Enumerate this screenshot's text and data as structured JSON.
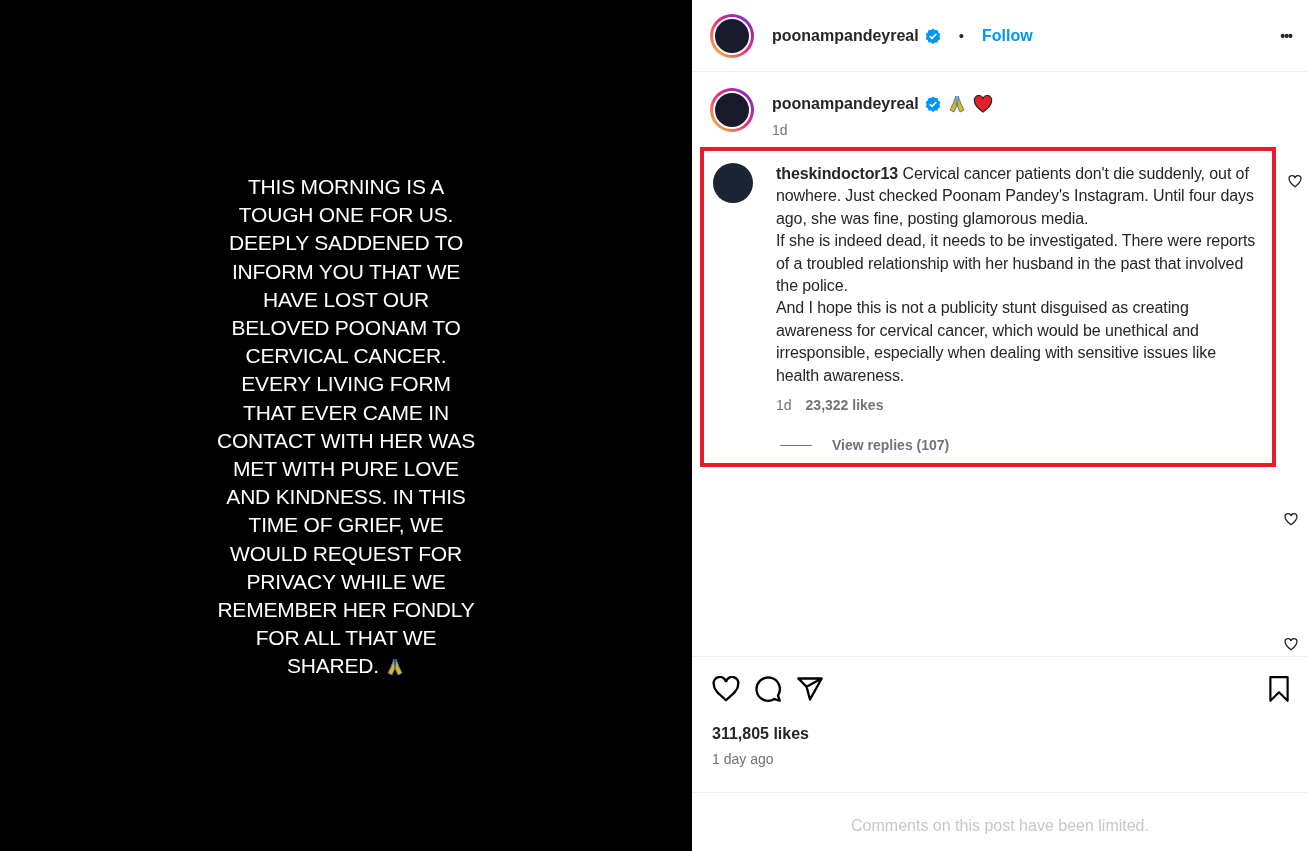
{
  "post_image": {
    "lines": [
      "THIS MORNING IS A",
      "TOUGH ONE FOR US.",
      "DEEPLY SADDENED TO",
      "INFORM YOU THAT WE",
      "HAVE LOST OUR",
      "BELOVED POONAM TO",
      "CERVICAL CANCER.",
      "EVERY LIVING FORM",
      "THAT EVER CAME IN",
      "CONTACT WITH HER WAS",
      "MET WITH PURE LOVE",
      "AND KINDNESS. IN THIS",
      "TIME OF GRIEF, WE",
      "WOULD REQUEST FOR",
      "PRIVACY WHILE WE",
      "REMEMBER HER FONDLY",
      "FOR ALL THAT WE",
      "SHARED."
    ]
  },
  "header": {
    "username": "poonampandeyreal",
    "verified": true,
    "separator": "•",
    "follow": "Follow",
    "more": "•••"
  },
  "caption": {
    "username": "poonampandeyreal",
    "verified": true,
    "time": "1d"
  },
  "comments": [
    {
      "text": "**theskindoctor13** Cervical cancer patients don't die suddenly, out of nowhere. Just checked Poonam Pandey's Instagram. Until four days ago, she was fine, posting glamorous media.\nIf she is indeed dead, it needs to be investigated. There were reports of a troubled relationship with her husband in the past that involved the police.\nAnd I hope this is not a publicity stunt disguised as creating awareness for cervical cancer, which would be unethical and irresponsible, especially when dealing with sensitive issues like health awareness.",
      "time": "1d",
      "likes": "23,322 likes",
      "replies": "View replies (107)",
      "highlighted": true
    }
  ],
  "likes": "311,805 likes",
  "posted": "1 day ago",
  "footer": "Comments on this post have been limited."
}
